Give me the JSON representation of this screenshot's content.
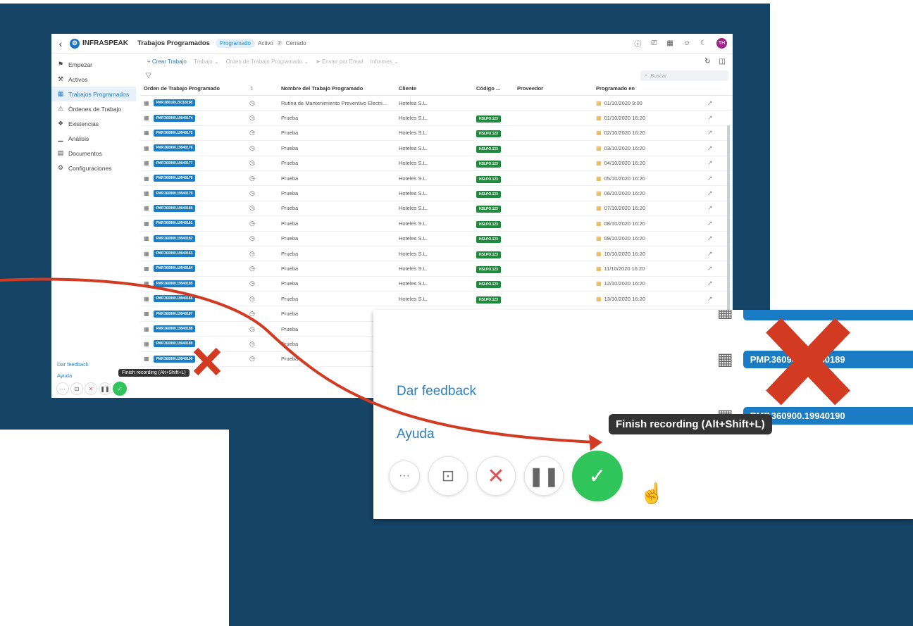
{
  "app": {
    "logo": "INFRASPEAK",
    "page_title": "Trabajos Programados",
    "status_tabs": [
      {
        "label": "Programado",
        "active": true
      },
      {
        "label": "Activo",
        "count": "2"
      },
      {
        "label": "Cerrado"
      }
    ],
    "avatar_initials": "TH"
  },
  "sidebar": {
    "items": [
      {
        "label": "Empezar",
        "icon": "flag-icon"
      },
      {
        "label": "Activos",
        "icon": "wrench-icon"
      },
      {
        "label": "Trabajos Programados",
        "icon": "calendar-icon",
        "active": true
      },
      {
        "label": "Órdenes de Trabajo",
        "icon": "warning-icon"
      },
      {
        "label": "Existencias",
        "icon": "boxes-icon"
      },
      {
        "label": "Análisis",
        "icon": "chart-icon"
      },
      {
        "label": "Documentos",
        "icon": "document-icon"
      },
      {
        "label": "Configuraciones",
        "icon": "gear-icon"
      }
    ],
    "feedback": "Dar feedback",
    "help": "Ayuda"
  },
  "toolbar": {
    "create": "+ Crear Trabajo",
    "job": "Trabajo",
    "order": "Orden de Trabajo Programado",
    "email": "Enviar por Email",
    "reports": "Informes"
  },
  "search_placeholder": "Buscar",
  "table": {
    "columns": [
      "Orden de Trabajo Programado",
      "Nombre del Trabajo Programado",
      "Cliente",
      "Código ...",
      "Proveedor",
      "Programado en"
    ],
    "rows": [
      {
        "id": "PMP.380189.20118198",
        "name": "Rutina de Mantenimiento Preventivo Electri...",
        "client": "Hoteles S.L.",
        "code": "",
        "date": "01/10/2020 9:00"
      },
      {
        "id": "PMP.360900.19940174",
        "name": "Prueba",
        "client": "Hoteles S.L.",
        "code": "HSLPO.123",
        "date": "01/10/2020 16:20"
      },
      {
        "id": "PMP.360900.19940175",
        "name": "Prueba",
        "client": "Hoteles S.L.",
        "code": "HSLPO.123",
        "date": "02/10/2020 16:20"
      },
      {
        "id": "PMP.360900.19940176",
        "name": "Prueba",
        "client": "Hoteles S.L.",
        "code": "HSLPO.123",
        "date": "03/10/2020 16:20"
      },
      {
        "id": "PMP.360900.19940177",
        "name": "Prueba",
        "client": "Hoteles S.L.",
        "code": "HSLPO.123",
        "date": "04/10/2020 16:20"
      },
      {
        "id": "PMP.360900.19940178",
        "name": "Prueba",
        "client": "Hoteles S.L.",
        "code": "HSLPO.123",
        "date": "05/10/2020 16:20"
      },
      {
        "id": "PMP.360900.19940179",
        "name": "Prueba",
        "client": "Hoteles S.L.",
        "code": "HSLPO.123",
        "date": "06/10/2020 16:20"
      },
      {
        "id": "PMP.360900.19940180",
        "name": "Prueba",
        "client": "Hoteles S.L.",
        "code": "HSLPO.123",
        "date": "07/10/2020 16:20"
      },
      {
        "id": "PMP.360900.19940181",
        "name": "Prueba",
        "client": "Hoteles S.L.",
        "code": "HSLPO.123",
        "date": "08/10/2020 16:20"
      },
      {
        "id": "PMP.360900.19940182",
        "name": "Prueba",
        "client": "Hoteles S.L.",
        "code": "HSLPO.123",
        "date": "09/10/2020 16:20"
      },
      {
        "id": "PMP.360900.19940183",
        "name": "Prueba",
        "client": "Hoteles S.L.",
        "code": "HSLPO.123",
        "date": "10/10/2020 16:20"
      },
      {
        "id": "PMP.360900.19940184",
        "name": "Prueba",
        "client": "Hoteles S.L.",
        "code": "HSLPO.123",
        "date": "11/10/2020 16:20"
      },
      {
        "id": "PMP.360900.19940185",
        "name": "Prueba",
        "client": "Hoteles S.L.",
        "code": "HSLPO.123",
        "date": "12/10/2020 16:20"
      },
      {
        "id": "PMP.360900.19940186",
        "name": "Prueba",
        "client": "Hoteles S.L.",
        "code": "HSLPO.123",
        "date": "13/10/2020 16:20"
      },
      {
        "id": "PMP.360900.19940187",
        "name": "Prueba",
        "client": "",
        "code": "",
        "date": ""
      },
      {
        "id": "PMP.360900.19940188",
        "name": "Prueba",
        "client": "",
        "code": "",
        "date": ""
      },
      {
        "id": "PMP.360900.19940189",
        "name": "Prueba",
        "client": "",
        "code": "",
        "date": ""
      },
      {
        "id": "PMP.360900.19940190",
        "name": "Prueba",
        "client": "",
        "code": "",
        "date": ""
      }
    ]
  },
  "recorder": {
    "tooltip": "Finish recording (Alt+Shift+L)"
  },
  "zoom": {
    "feedback": "Dar feedback",
    "help": "Ayuda",
    "tag1": "PMP.360900.19940189",
    "tag2": "PMP.360900.19940190",
    "tooltip": "Finish recording (Alt+Shift+L)"
  },
  "colors": {
    "background": "#164466",
    "accent": "#1a7cc5",
    "green": "#2fc55a",
    "annotation": "#d23a22"
  }
}
